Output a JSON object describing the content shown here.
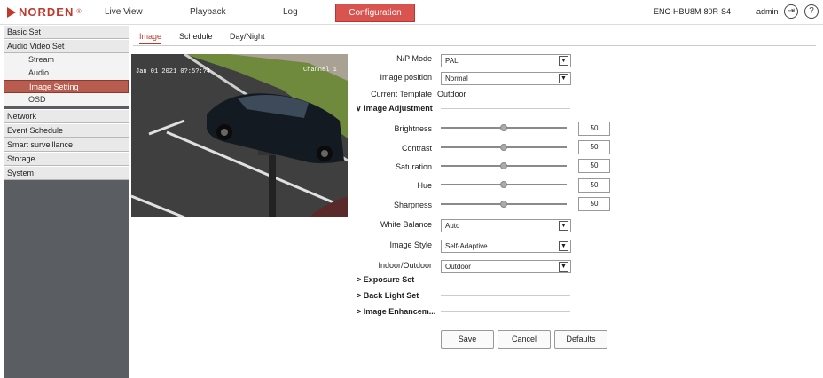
{
  "brand": {
    "name": "NORDEN",
    "reg": "®"
  },
  "nav": {
    "live_view": "Live View",
    "playback": "Playback",
    "log": "Log",
    "configuration": "Configuration"
  },
  "header": {
    "device": "ENC-HBU8M-80R-S4",
    "user": "admin",
    "logout_icon": "logout-icon",
    "help_icon": "help-icon"
  },
  "sidebar": {
    "basic_set": "Basic Set",
    "audio_video_set": "Audio Video Set",
    "sub": [
      "Stream",
      "Audio",
      "Image Setting",
      "OSD"
    ],
    "network": "Network",
    "event_schedule": "Event Schedule",
    "smart_surveillance": "Smart surveillance",
    "storage": "Storage",
    "system": "System"
  },
  "tabs": [
    "Image",
    "Schedule",
    "Day/Night"
  ],
  "video": {
    "timestamp": "Jan 01 2021 0?:5?:?4",
    "channel": "Channel 1"
  },
  "form": {
    "np_mode": {
      "label": "N/P Mode",
      "value": "PAL"
    },
    "image_position": {
      "label": "Image position",
      "value": "Normal"
    },
    "current_template": {
      "label": "Current Template",
      "value": "Outdoor"
    },
    "image_adjustment": "Image Adjustment",
    "brightness": {
      "label": "Brightness",
      "value": "50"
    },
    "contrast": {
      "label": "Contrast",
      "value": "50"
    },
    "saturation": {
      "label": "Saturation",
      "value": "50"
    },
    "hue": {
      "label": "Hue",
      "value": "50"
    },
    "sharpness": {
      "label": "Sharpness",
      "value": "50"
    },
    "white_balance": {
      "label": "White Balance",
      "value": "Auto"
    },
    "image_style": {
      "label": "Image Style",
      "value": "Self-Adaptive"
    },
    "indoor_outdoor": {
      "label": "Indoor/Outdoor",
      "value": "Outdoor"
    },
    "exposure_set": "Exposure Set",
    "back_light_set": "Back Light Set",
    "image_enhancement": "Image Enhancem..."
  },
  "buttons": {
    "save": "Save",
    "cancel": "Cancel",
    "defaults": "Defaults"
  },
  "glyphs": {
    "dropdown": "▼",
    "expanded": "∨",
    "collapsed": ">",
    "logout": "⇥",
    "help": "?"
  },
  "colors": {
    "accent": "#c0392b",
    "active_nav": "#d9534f",
    "sidebar_bg": "#5a5d62"
  }
}
